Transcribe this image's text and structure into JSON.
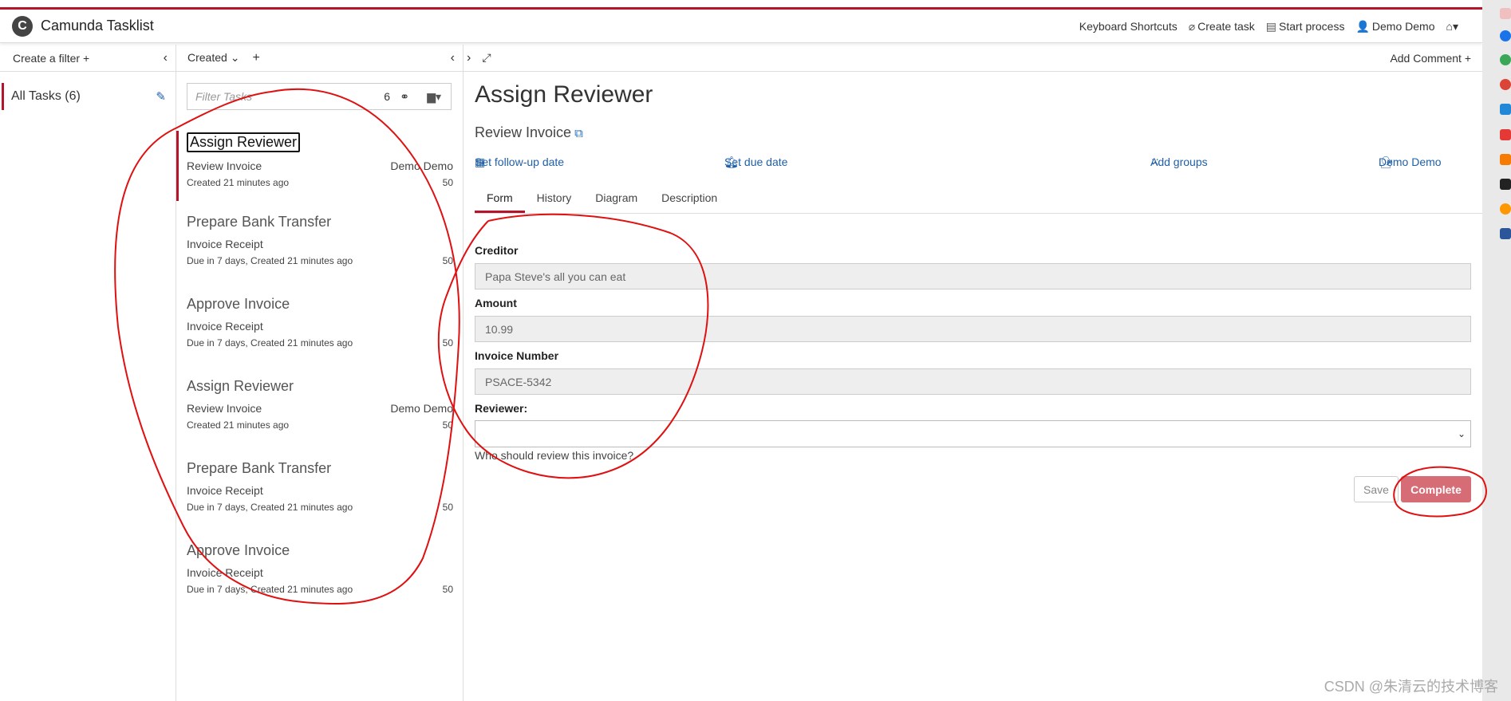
{
  "app": {
    "title": "Camunda Tasklist",
    "logo_letter": "C"
  },
  "top_actions": {
    "keyboard": "Keyboard Shortcuts",
    "create_task": "Create task",
    "start_process": "Start process",
    "user": "Demo Demo"
  },
  "filters": {
    "create_label": "Create a filter",
    "items": [
      {
        "label": "All Tasks (6)"
      }
    ]
  },
  "list": {
    "sort_label": "Created",
    "search_placeholder": "Filter Tasks",
    "count": "6",
    "tasks": [
      {
        "name": "Assign Reviewer",
        "process": "Review Invoice",
        "assignee": "Demo Demo",
        "meta": "Created 21 minutes ago",
        "priority": "50"
      },
      {
        "name": "Prepare Bank Transfer",
        "process": "Invoice Receipt",
        "assignee": "",
        "meta": "Due in 7 days, Created 21 minutes ago",
        "priority": "50"
      },
      {
        "name": "Approve Invoice",
        "process": "Invoice Receipt",
        "assignee": "",
        "meta": "Due in 7 days, Created 21 minutes ago",
        "priority": "50"
      },
      {
        "name": "Assign Reviewer",
        "process": "Review Invoice",
        "assignee": "Demo Demo",
        "meta": "Created 21 minutes ago",
        "priority": "50"
      },
      {
        "name": "Prepare Bank Transfer",
        "process": "Invoice Receipt",
        "assignee": "",
        "meta": "Due in 7 days, Created 21 minutes ago",
        "priority": "50"
      },
      {
        "name": "Approve Invoice",
        "process": "Invoice Receipt",
        "assignee": "",
        "meta": "Due in 7 days, Created 21 minutes ago",
        "priority": "50"
      }
    ]
  },
  "detail": {
    "add_comment": "Add Comment",
    "title": "Assign Reviewer",
    "process": "Review Invoice",
    "follow_up": "Set follow-up date",
    "due_date": "Set due date",
    "add_groups": "Add groups",
    "assignee": "Demo Demo",
    "tabs": [
      "Form",
      "History",
      "Diagram",
      "Description"
    ],
    "form": {
      "creditor_label": "Creditor",
      "creditor_value": "Papa Steve's all you can eat",
      "amount_label": "Amount",
      "amount_value": "10.99",
      "invoice_label": "Invoice Number",
      "invoice_value": "PSACE-5342",
      "reviewer_label": "Reviewer:",
      "reviewer_help": "Who should review this invoice?",
      "save": "Save",
      "complete": "Complete"
    }
  },
  "watermark": "CSDN @朱清云的技术博客",
  "colors": {
    "accent": "#b5152b",
    "link": "#1f5fa8",
    "complete": "#d56c76",
    "annotation": "#e01010"
  }
}
